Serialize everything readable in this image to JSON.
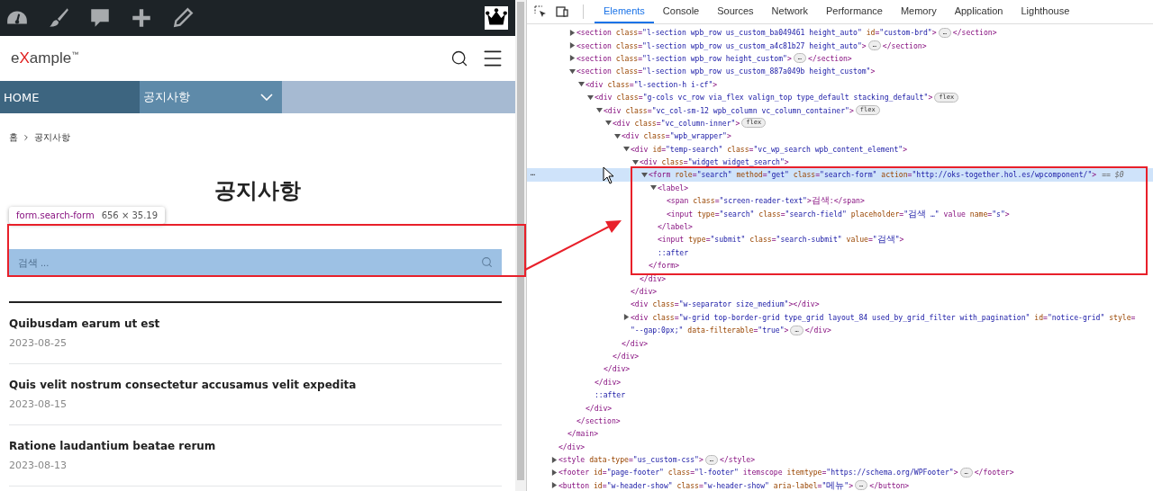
{
  "site": {
    "logo": {
      "before": "e",
      "accent": "X",
      "after": "ample",
      "mark": "™"
    },
    "nav": [
      {
        "label": "HOME",
        "dropdown": false
      },
      {
        "label": "공지사항",
        "dropdown": true
      }
    ],
    "breadcrumb": [
      "홈",
      "공지사항"
    ],
    "page_title": "공지사항",
    "search": {
      "placeholder": "검색 ..."
    },
    "posts": [
      {
        "title": "Quibusdam earum ut est",
        "date": "2023-08-25"
      },
      {
        "title": "Quis velit nostrum consectetur accusamus velit expedita",
        "date": "2023-08-15"
      },
      {
        "title": "Ratione laudantium beatae rerum",
        "date": "2023-08-13"
      }
    ]
  },
  "inspect_tooltip": {
    "selector": "form.search-form",
    "size": "656 × 35.19"
  },
  "devtools": {
    "tabs": [
      {
        "label": "Elements",
        "selected": true
      },
      {
        "label": "Console",
        "selected": false
      },
      {
        "label": "Sources",
        "selected": false
      },
      {
        "label": "Network",
        "selected": false
      },
      {
        "label": "Performance",
        "selected": false
      },
      {
        "label": "Memory",
        "selected": false
      },
      {
        "label": "Application",
        "selected": false
      },
      {
        "label": "Lighthouse",
        "selected": false
      }
    ],
    "tree": [
      {
        "close": "</div>",
        "children": [
          {
            "close": "</main>",
            "children": [
              {
                "text": "<section class=\"l-section wpb_row us_custom_ba049461 height_auto\" id=\"custom-brd\">",
                "badge": "…",
                "tail": "</section>",
                "expanded": false,
                "selected": false
              },
              {
                "text": "<section class=\"l-section wpb_row us_custom_a4c81b27 height_auto\">",
                "badge": "…",
                "tail": "</section>",
                "expanded": false,
                "selected": false
              },
              {
                "text": "<section class=\"l-section wpb_row height_custom\">",
                "badge": "…",
                "tail": "</section>",
                "expanded": false,
                "selected": false
              },
              {
                "text": "<section class=\"l-section wpb_row us_custom_887a049b height_custom\">",
                "expanded": true,
                "selected": false,
                "close": "</section>",
                "children": [
                  {
                    "text": "<div class=\"l-section-h i-cf\">",
                    "expanded": true,
                    "selected": false,
                    "close": "</div>",
                    "children": [
                      {
                        "text": "<div class=\"g-cols vc_row via_flex valign_top type_default stacking_default\">",
                        "badge": "flex",
                        "expanded": true,
                        "selected": false,
                        "close": "</div>",
                        "children": [
                          {
                            "text": "<div class=\"vc_col-sm-12 wpb_column vc_column_container\">",
                            "badge": "flex",
                            "expanded": true,
                            "selected": false,
                            "close": "</div>",
                            "children": [
                              {
                                "text": "<div class=\"vc_column-inner\">",
                                "badge": "flex",
                                "expanded": true,
                                "selected": false,
                                "close": "</div>",
                                "children": [
                                  {
                                    "text": "<div class=\"wpb_wrapper\">",
                                    "expanded": true,
                                    "selected": false,
                                    "close": "</div>",
                                    "children": [
                                      {
                                        "text": "<div id=\"temp-search\" class=\"vc_wp_search wpb_content_element\">",
                                        "expanded": true,
                                        "selected": false,
                                        "close": "</div>",
                                        "children": [
                                          {
                                            "text": "<div class=\"widget widget_search\">",
                                            "expanded": true,
                                            "selected": false,
                                            "close": "</div>",
                                            "children": [
                                              {
                                                "text": "<form role=\"search\" method=\"get\" class=\"search-form\" action=\"http://oks-together.hol.es/wpcomponent/\">",
                                                "suffix": "== $0",
                                                "marker": "⋯",
                                                "expanded": true,
                                                "selected": true,
                                                "close": "</form>",
                                                "children": [
                                                  {
                                                    "text": "<label>",
                                                    "expanded": true,
                                                    "selected": false,
                                                    "close": "</label>",
                                                    "children": [
                                                      {
                                                        "text": "<span class=\"screen-reader-text\">검색:</span>",
                                                        "selected": false
                                                      },
                                                      {
                                                        "text": "<input type=\"search\" class=\"search-field\" placeholder=\"검색 …\" value name=\"s\">",
                                                        "selected": false
                                                      }
                                                    ]
                                                  },
                                                  {
                                                    "text": "<input type=\"submit\" class=\"search-submit\" value=\"검색\">",
                                                    "selected": false
                                                  },
                                                  {
                                                    "text": "::after",
                                                    "kind": "pseudo",
                                                    "selected": false
                                                  }
                                                ]
                                              }
                                            ]
                                          }
                                        ]
                                      },
                                      {
                                        "text": "<div class=\"w-separator size_medium\"></div>",
                                        "selected": false
                                      },
                                      {
                                        "text": "<div class=\"w-grid top-border-grid type_grid layout_84 used_by_grid_filter with_pagination\" id=\"notice-grid\" style=",
                                        "wrap": "\"--gap:0px;\" data-filterable=\"true\">",
                                        "badge": "…",
                                        "tail": "</div>",
                                        "expanded": false,
                                        "selected": false
                                      }
                                    ]
                                  }
                                ]
                              }
                            ]
                          }
                        ]
                      },
                      {
                        "text": "::after",
                        "kind": "pseudo",
                        "selected": false
                      }
                    ]
                  }
                ]
              }
            ]
          }
        ]
      },
      {
        "text": "<style data-type=\"us_custom-css\">",
        "badge": "…",
        "tail": "</style>",
        "expanded": false,
        "selected": false
      },
      {
        "text": "<footer id=\"page-footer\" class=\"l-footer\" itemscope itemtype=\"https://schema.org/WPFooter\">",
        "badge": "…",
        "tail": "</footer>",
        "expanded": false,
        "selected": false
      },
      {
        "text": "<button id=\"w-header-show\" class=\"w-header-show\" aria-label=\"메뉴\">",
        "badge": "…",
        "tail": "</button>",
        "expanded": false,
        "selected": false
      }
    ]
  }
}
